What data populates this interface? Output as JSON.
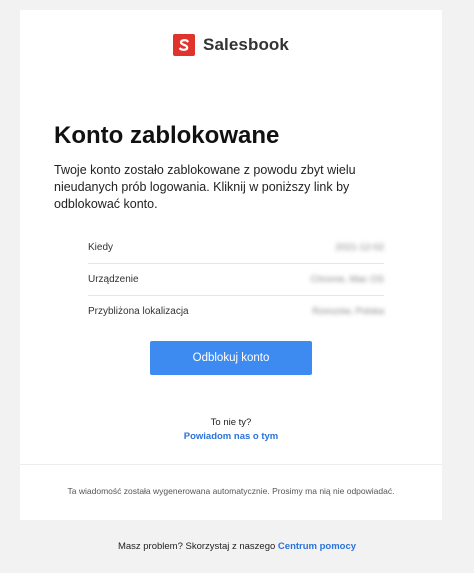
{
  "brand": {
    "name": "Salesbook",
    "accent_color": "#e0332c"
  },
  "email": {
    "title": "Konto zablokowane",
    "intro": "Twoje konto zostało zablokowane z powodu zbyt wielu nieudanych prób logowania. Kliknij w poniższy link by odblokować konto.",
    "details": [
      {
        "label": "Kiedy",
        "value": "2021-12-02"
      },
      {
        "label": "Urządzenie",
        "value": "Chrome, Mac OS"
      },
      {
        "label": "Przybliżona lokalizacja",
        "value": "Rzeszów, Polska"
      }
    ],
    "unlock_button": "Odblokuj konto",
    "not_you": "To nie ty?",
    "notify_link": "Powiadom nas o tym",
    "auto_note": "Ta wiadomość została wygenerowana automatycznie. Prosimy ma nią nie odpowiadać."
  },
  "footer": {
    "text": "Masz problem? Skorzystaj z naszego",
    "help_link": "Centrum pomocy"
  },
  "colors": {
    "button": "#3d8bf0",
    "link": "#2a73d9"
  }
}
